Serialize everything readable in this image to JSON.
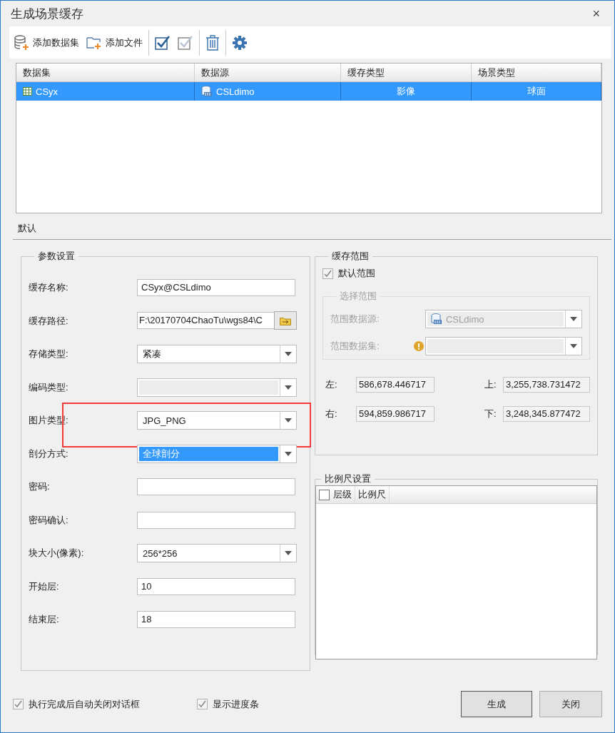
{
  "window": {
    "title": "生成场景缓存",
    "close": "×"
  },
  "toolbar": [
    {
      "kind": "db-add",
      "label": "添加数据集"
    },
    {
      "kind": "folder-add",
      "label": "添加文件"
    },
    {
      "kind": "sep"
    },
    {
      "kind": "check-all"
    },
    {
      "kind": "check-none"
    },
    {
      "kind": "sep"
    },
    {
      "kind": "delete"
    },
    {
      "kind": "sep"
    },
    {
      "kind": "settings"
    }
  ],
  "table": {
    "columns": [
      "数据集",
      "数据源",
      "缓存类型",
      "场景类型"
    ],
    "rows": [
      {
        "selected": true,
        "dataset": "CSyx",
        "datasource": "CSLdimo",
        "cache_type": "影像",
        "scene_type": "球面"
      }
    ]
  },
  "tabs": [
    {
      "label": "默认",
      "selected": true
    }
  ],
  "params": {
    "title": "参数设置",
    "fields": [
      {
        "kind": "text",
        "label": "缓存名称:",
        "value": "CSyx@CSLdimo",
        "disabled": false,
        "focused": false,
        "highlighted": false
      },
      {
        "kind": "path",
        "label": "缓存路径:",
        "value": "F:\\20170704ChaoTu\\wgs84\\C",
        "disabled": false,
        "focused": false,
        "highlighted": false
      },
      {
        "kind": "select",
        "label": "存储类型:",
        "value": "紧凑",
        "disabled": false,
        "focused": false,
        "highlighted": false
      },
      {
        "kind": "select",
        "label": "编码类型:",
        "disabled": true,
        "focused": false,
        "highlighted": false
      },
      {
        "kind": "select",
        "label": "图片类型:",
        "value": "JPG_PNG",
        "disabled": false,
        "focused": false,
        "highlighted": true
      },
      {
        "kind": "select",
        "label": "剖分方式:",
        "value": "全球剖分",
        "disabled": false,
        "focused": true,
        "highlighted": false
      },
      {
        "kind": "text",
        "label": "密码:",
        "disabled": false,
        "focused": false,
        "highlighted": false
      },
      {
        "kind": "text",
        "label": "密码确认:",
        "disabled": false,
        "focused": false,
        "highlighted": false
      },
      {
        "kind": "select",
        "label": "块大小(像素):",
        "value": "256*256",
        "disabled": false,
        "focused": false,
        "highlighted": false
      },
      {
        "kind": "text",
        "label": "开始层:",
        "value": "10",
        "disabled": false,
        "focused": false,
        "highlighted": false
      },
      {
        "kind": "text",
        "label": "结束层:",
        "value": "18",
        "disabled": false,
        "focused": false,
        "highlighted": false
      }
    ]
  },
  "extent": {
    "title": "缓存范围",
    "default_checkbox": {
      "label": "默认范围",
      "checked": true
    },
    "select_group": {
      "title": "选择范围",
      "datasource_label": "范围数据源:",
      "datasource_value": "CSLdimo",
      "dataset_label": "范围数据集:"
    },
    "bounds": [
      {
        "label": "左:",
        "value": "586,678.446717"
      },
      {
        "label": "上:",
        "value": "3,255,738.731472"
      },
      {
        "label": "右:",
        "value": "594,859.986717"
      },
      {
        "label": "下:",
        "value": "3,248,345.877472"
      }
    ]
  },
  "scale": {
    "title": "比例尺设置",
    "header_checked": false,
    "columns": [
      "层级",
      "比例尺"
    ]
  },
  "options": [
    {
      "label": "执行完成后自动关闭对话框",
      "checked": true
    },
    {
      "label": "显示进度条",
      "checked": true
    }
  ],
  "buttons": [
    {
      "label": "生成",
      "default": true
    },
    {
      "label": "关闭",
      "default": false
    }
  ]
}
